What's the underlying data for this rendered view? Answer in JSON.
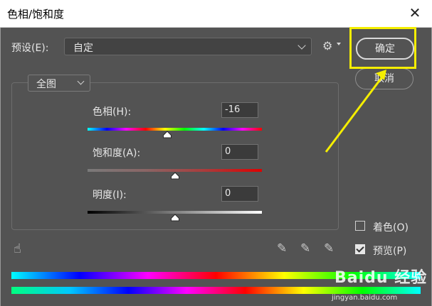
{
  "window": {
    "title": "色相/饱和度",
    "close_glyph": "✕"
  },
  "preset": {
    "label": "预设(E):",
    "value": "自定"
  },
  "buttons": {
    "ok": "确定",
    "cancel": "取消"
  },
  "range": {
    "value": "全图"
  },
  "hue": {
    "label": "色相(H):",
    "value": "-16",
    "level": -16,
    "min": -180,
    "max": 180
  },
  "saturation": {
    "label": "饱和度(A):",
    "value": "0",
    "level": 0,
    "min": -100,
    "max": 100
  },
  "lightness": {
    "label": "明度(I):",
    "value": "0",
    "level": 0,
    "min": -100,
    "max": 100
  },
  "options": {
    "colorize": {
      "label": "着色(O)",
      "checked": false
    },
    "preview": {
      "label": "预览(P)",
      "checked": true
    }
  },
  "icons": [
    "gear-icon",
    "hand-adjust-icon",
    "eyedropper-icon",
    "eyedropper-add-icon",
    "eyedropper-subtract-icon"
  ],
  "colors": {
    "highlight": "#f5ee00",
    "panel": "#535353"
  },
  "watermark": {
    "logo": "Baidu 经验",
    "url": "jingyan.baidu.com"
  }
}
